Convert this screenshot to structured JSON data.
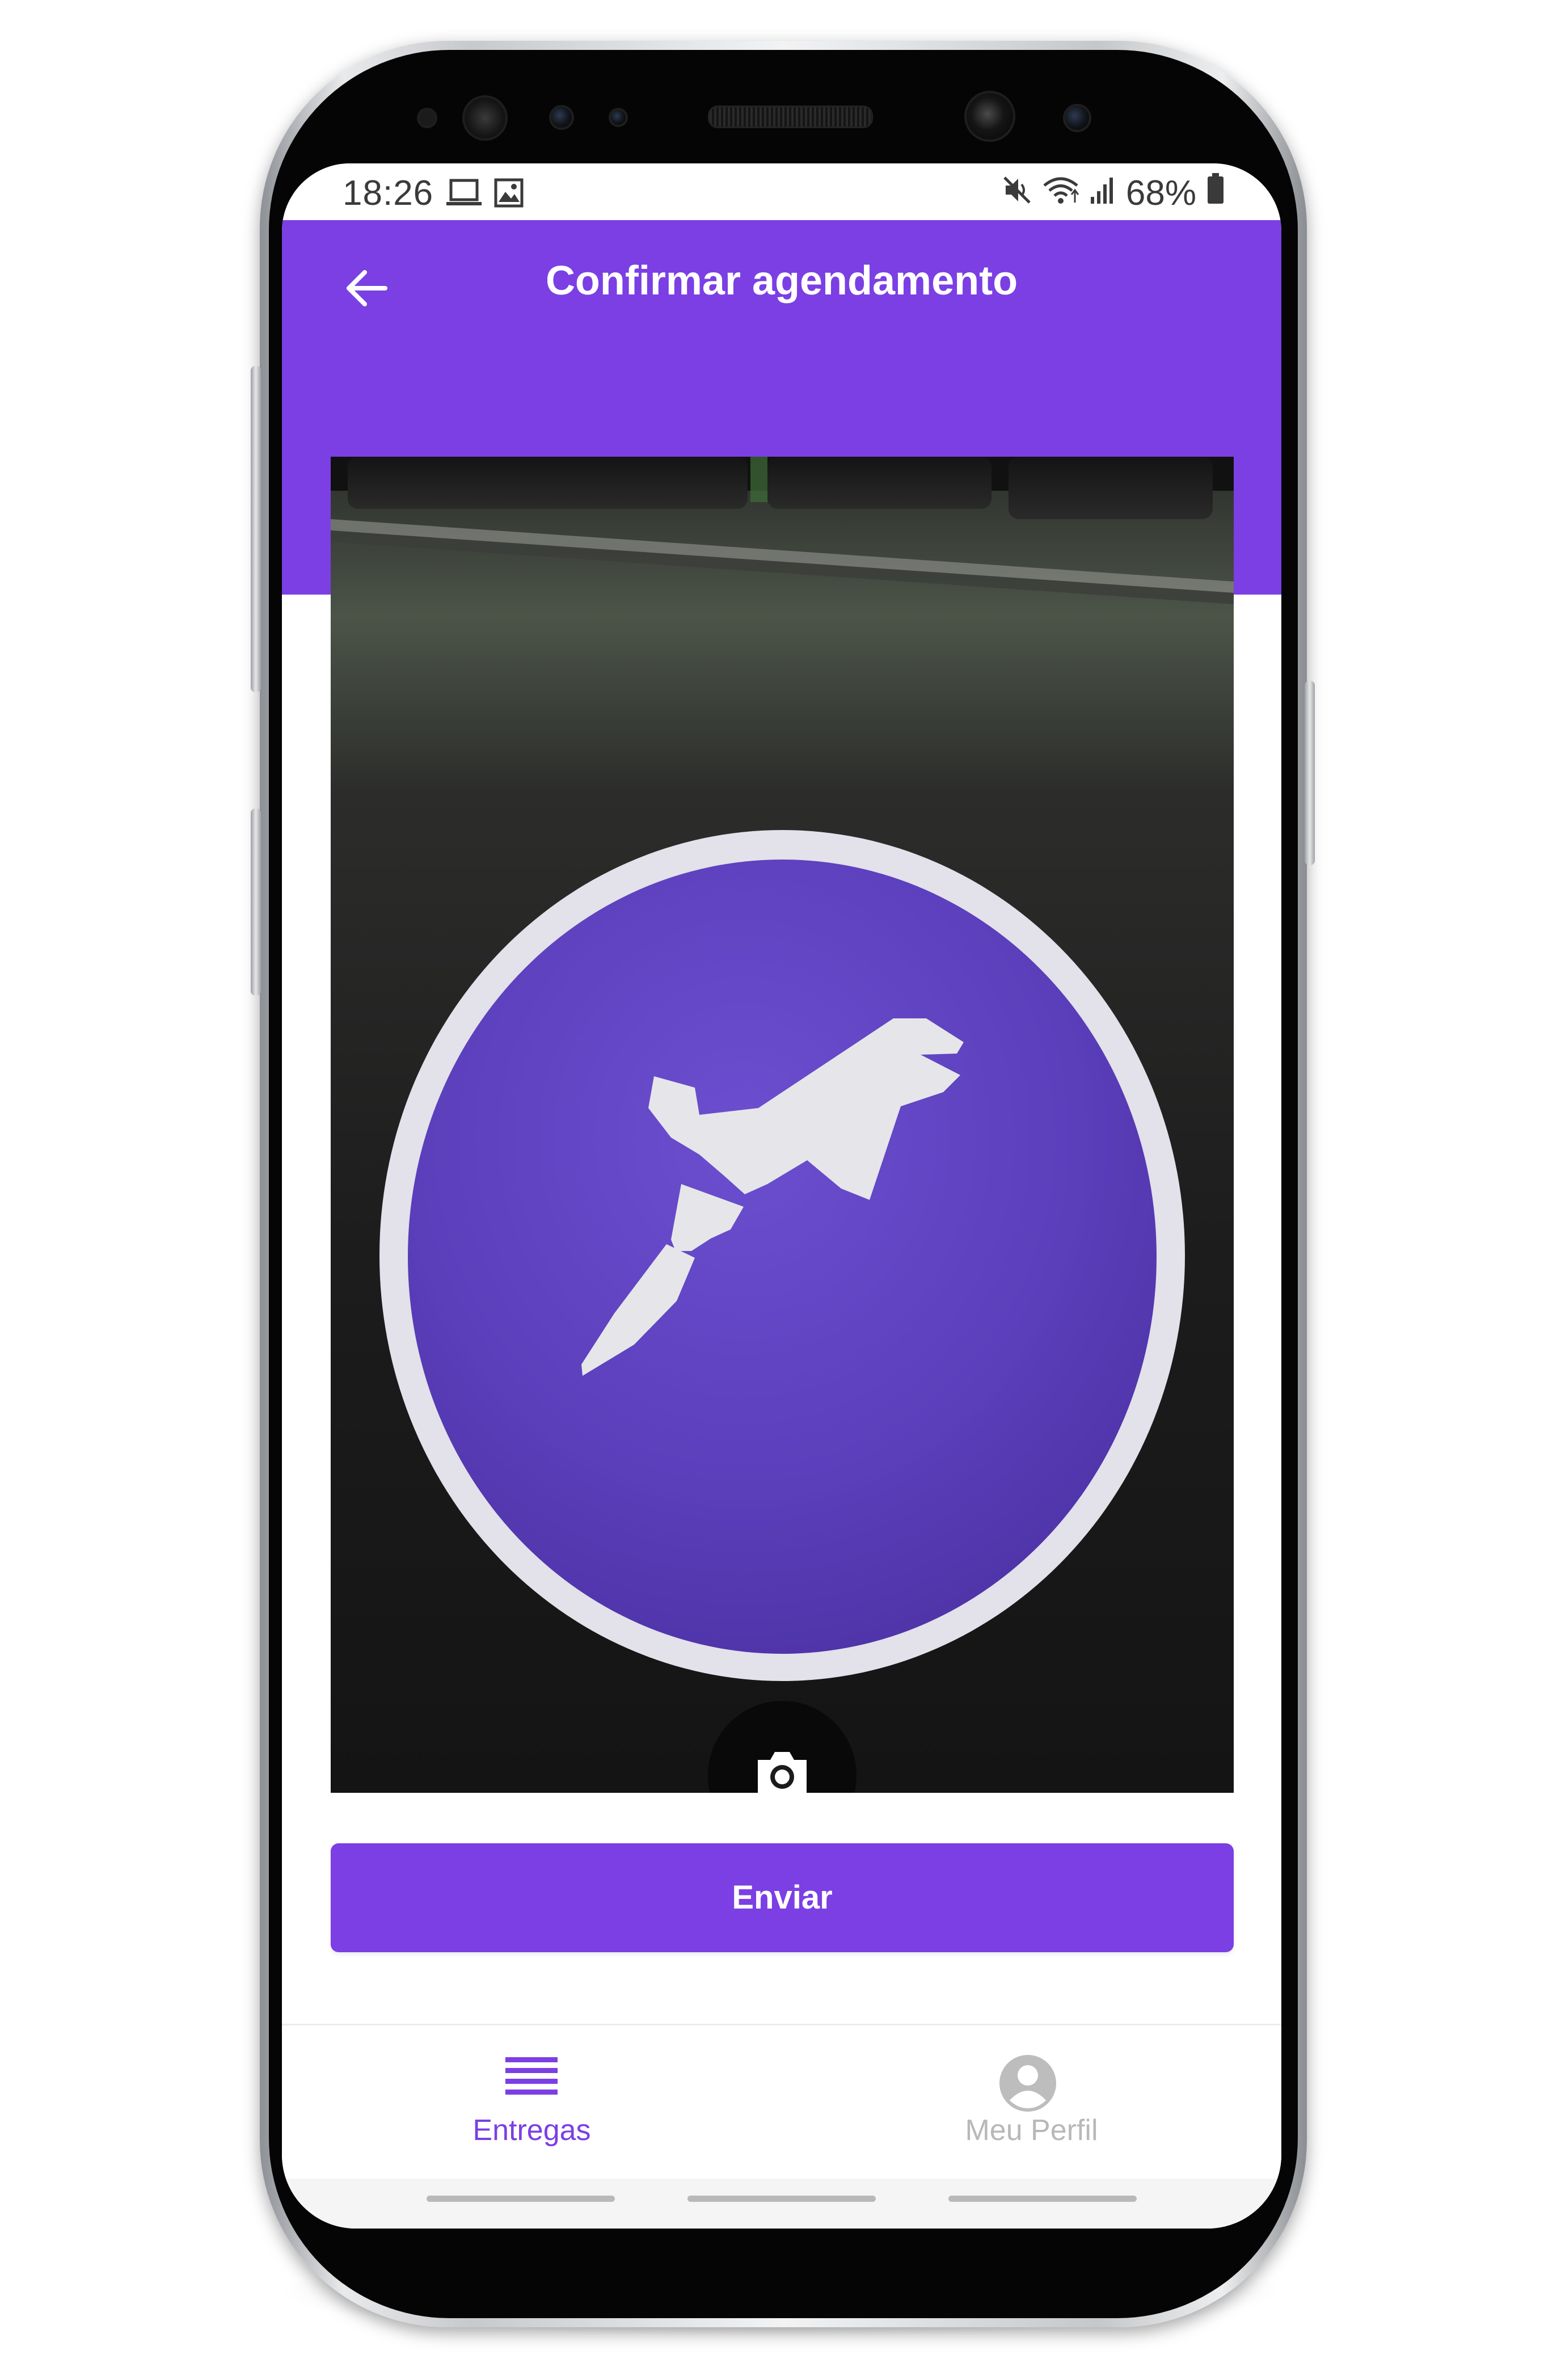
{
  "status_bar": {
    "time": "18:26",
    "battery": "68%",
    "left_icons": [
      "laptop-icon",
      "image-icon"
    ],
    "right_icons": [
      "mute-icon",
      "wifi-icon",
      "signal-icon",
      "battery-icon"
    ]
  },
  "header": {
    "title": "Confirmar agendamento",
    "back_icon": "arrow-left-icon"
  },
  "photo": {
    "camera_icon": "camera-icon",
    "colors": {
      "badge_purple": "#5b3fb8",
      "badge_ring": "#e8e6ee",
      "background_dark": "#1b1b1b"
    }
  },
  "actions": {
    "send_label": "Enviar"
  },
  "bottom_nav": {
    "items": [
      {
        "label": "Entregas",
        "icon": "list-icon",
        "active": true
      },
      {
        "label": "Meu Perfil",
        "icon": "user-circle-icon",
        "active": false
      }
    ]
  },
  "theme": {
    "primary": "#7b3fe4",
    "nav_active": "#7b3fe4",
    "nav_inactive": "#b8b8b8"
  }
}
